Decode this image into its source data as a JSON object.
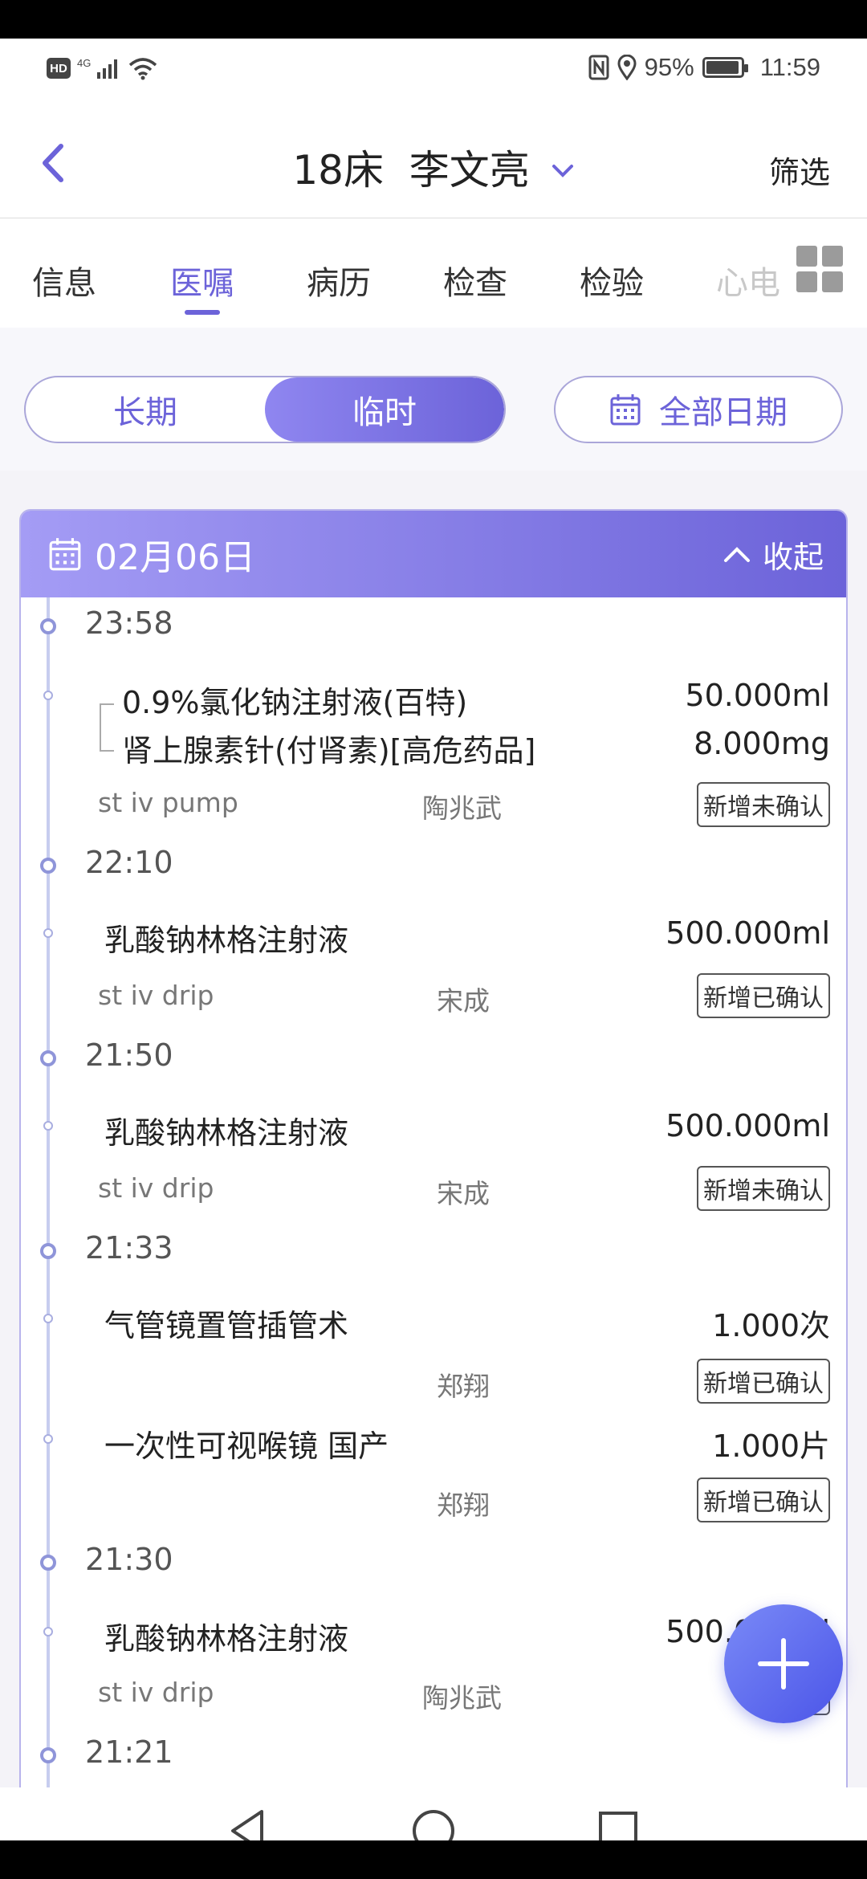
{
  "status_bar": {
    "hd": "HD",
    "network": "4G",
    "battery": "95%",
    "battery_level": 0.95,
    "time": "11:59"
  },
  "header": {
    "title": "18床  李文亮",
    "filter_label": "筛选"
  },
  "tabs": [
    {
      "label": "信息",
      "active": false
    },
    {
      "label": "医嘱",
      "active": true
    },
    {
      "label": "病历",
      "active": false
    },
    {
      "label": "检查",
      "active": false
    },
    {
      "label": "检验",
      "active": false
    },
    {
      "label": "心电",
      "active": false
    }
  ],
  "segment": {
    "long_term": "长期",
    "temporary": "临时",
    "selected": "临时"
  },
  "date_filter": "全部日期",
  "card": {
    "date": "02月06日",
    "collapse_label": "收起"
  },
  "orders": {
    "g1": {
      "time": "23:58",
      "item1": {
        "name": "0.9%氯化钠注射液(百特)",
        "dose": "50.000ml"
      },
      "item2": {
        "name": "肾上腺素针(付肾素)[高危药品]",
        "dose": "8.000mg"
      },
      "route": "st  iv pump",
      "doctor": "陶兆武",
      "status": "新增未确认"
    },
    "g2": {
      "time": "22:10",
      "name": "乳酸钠林格注射液",
      "dose": "500.000ml",
      "route": "st  iv drip",
      "doctor": "宋成",
      "status": "新增已确认"
    },
    "g3": {
      "time": "21:50",
      "name": "乳酸钠林格注射液",
      "dose": "500.000ml",
      "route": "st  iv drip",
      "doctor": "宋成",
      "status": "新增未确认"
    },
    "g4": {
      "time": "21:33",
      "item1": {
        "name": "气管镜置管插管术",
        "dose": "1.000次",
        "doctor": "郑翔",
        "status": "新增已确认"
      },
      "item2": {
        "name": "一次性可视喉镜 国产",
        "dose": "1.000片",
        "doctor": "郑翔",
        "status": "新增已确认"
      }
    },
    "g5": {
      "time": "21:30",
      "name": "乳酸钠林格注射液",
      "dose": "500.000ml",
      "route": "st  iv drip",
      "doctor": "陶兆武",
      "status": "新增"
    },
    "g6": {
      "time": "21:21"
    }
  },
  "colors": {
    "accent": "#6c63d9",
    "accent_light": "#a49cf5",
    "timeline": "#c7cdef"
  },
  "icons": [
    "back-arrow-icon",
    "dropdown-chevron-icon",
    "grid-menu-icon",
    "calendar-icon",
    "chevron-up-icon",
    "plus-icon",
    "nav-back-icon",
    "nav-home-icon",
    "nav-recents-icon"
  ]
}
